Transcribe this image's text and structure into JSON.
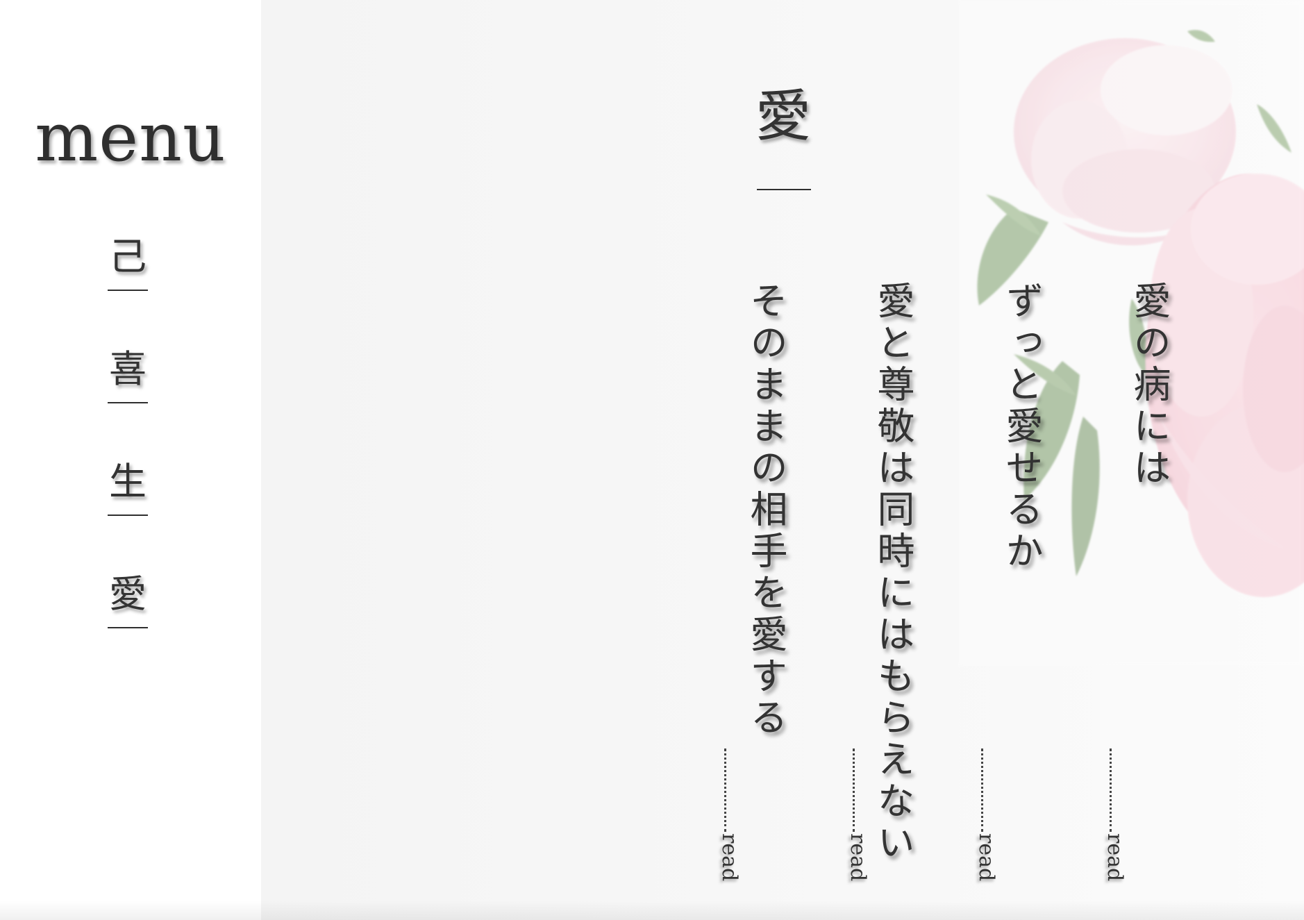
{
  "sidebar": {
    "title": "menu",
    "items": [
      {
        "label": "己"
      },
      {
        "label": "喜"
      },
      {
        "label": "生"
      },
      {
        "label": "愛"
      }
    ]
  },
  "section": {
    "title": "愛"
  },
  "articles": [
    {
      "title": "愛の病には",
      "read_label": "read"
    },
    {
      "title": "ずっと愛せるか",
      "read_label": "read"
    },
    {
      "title": "愛と尊敬は同時にはもらえない",
      "read_label": "read"
    },
    {
      "title": "そのままの相手を愛する",
      "read_label": "read"
    }
  ],
  "colors": {
    "sidebar_bg": "#ffffff",
    "main_bg": "#f6f6f6",
    "text": "#333333",
    "peony_pink": "#f4c8d2",
    "leaf_green": "#6f8f5c"
  },
  "decor": {
    "image_icon": "peony-flower-photo"
  }
}
